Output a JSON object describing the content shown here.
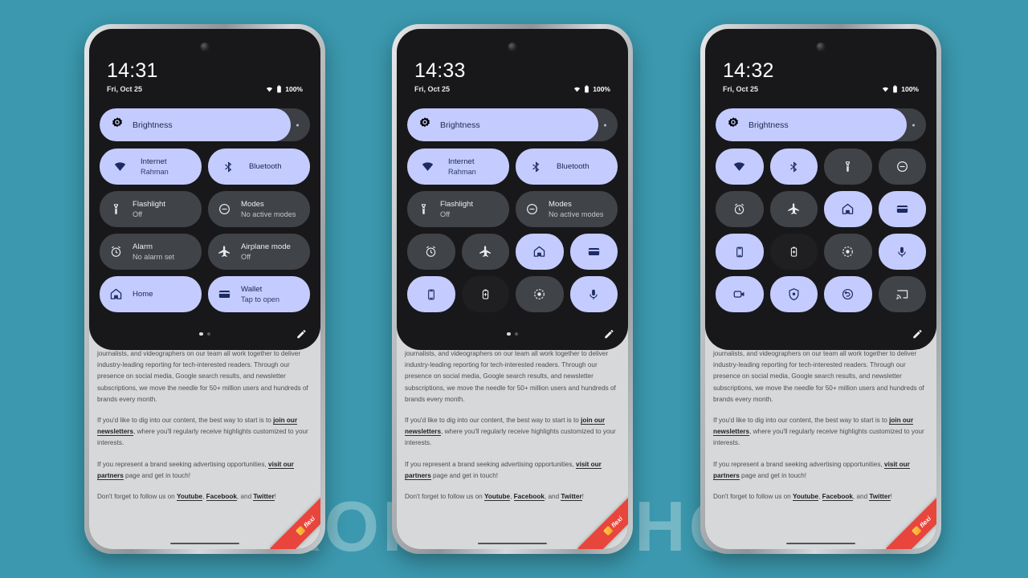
{
  "background": {
    "color": "#3b98ae",
    "watermark": "ANDROID AUTHORITY"
  },
  "ribbon": {
    "text": "flexi"
  },
  "article": {
    "p1": "journalists, and videographers on our team all work together to deliver industry-leading reporting for tech-interested readers. Through our presence on social media, Google search results, and newsletter subscriptions, we move the needle for 50+ million users and hundreds of brands every month.",
    "p2_a": "If you'd like to dig into our content, the best way to start is to ",
    "p2_link1": "join our newsletters",
    "p2_b": ", where you'll regularly receive highlights customized to your interests.",
    "p3_a": "If you represent a brand seeking advertising opportunities, ",
    "p3_link1": "visit our partners",
    "p3_b": " page and get in touch!",
    "p4_a": "Don't forget to follow us on ",
    "p4_link1": "Youtube",
    "p4_sep1": ", ",
    "p4_link2": "Facebook",
    "p4_sep2": ", and ",
    "p4_link3": "Twitter",
    "p4_end": "!"
  },
  "colors": {
    "tile_active_bg": "#c4ccff",
    "tile_active_fg": "#1d2a63",
    "tile_inactive_bg": "#404348",
    "tile_off_dark_bg": "#1f1f21",
    "panel_bg": "#18181a",
    "brightness_fill": "#c4ccff",
    "brightness_track": "#3c3f44"
  },
  "phones": [
    {
      "id": "phone-1",
      "layout": "wide-only",
      "status": {
        "time": "14:31",
        "date": "Fri, Oct 25",
        "battery": "100%",
        "wifi_icon": "wifi-icon",
        "battery_icon": "battery-icon"
      },
      "brightness": {
        "label": "Brightness",
        "icon": "brightness-icon",
        "percent": 91
      },
      "rows": [
        [
          {
            "name": "internet",
            "icon": "wifi-icon",
            "title": "Internet",
            "subtitle": "Rahman",
            "state": "on",
            "style": "bubble"
          },
          {
            "name": "bluetooth",
            "icon": "bluetooth-icon",
            "title": "Bluetooth",
            "subtitle": "",
            "state": "on",
            "style": "bubble"
          }
        ],
        [
          {
            "name": "flashlight",
            "icon": "flashlight-icon",
            "title": "Flashlight",
            "subtitle": "Off",
            "state": "off",
            "style": "plain"
          },
          {
            "name": "modes",
            "icon": "modes-icon",
            "title": "Modes",
            "subtitle": "No active modes",
            "state": "off",
            "style": "plain"
          }
        ],
        [
          {
            "name": "alarm",
            "icon": "alarm-icon",
            "title": "Alarm",
            "subtitle": "No alarm set",
            "state": "off",
            "style": "plain"
          },
          {
            "name": "airplane-mode",
            "icon": "airplane-icon",
            "title": "Airplane mode",
            "subtitle": "Off",
            "state": "off",
            "style": "plain"
          }
        ],
        [
          {
            "name": "home",
            "icon": "home-icon",
            "title": "Home",
            "subtitle": "",
            "state": "on",
            "style": "plain"
          },
          {
            "name": "wallet",
            "icon": "wallet-icon",
            "title": "Wallet",
            "subtitle": "Tap to open",
            "state": "on",
            "style": "plain"
          }
        ]
      ],
      "footer": {
        "dots": 2,
        "active_dot": 0,
        "edit_icon": "pencil-icon"
      }
    },
    {
      "id": "phone-2",
      "layout": "mixed",
      "status": {
        "time": "14:33",
        "date": "Fri, Oct 25",
        "battery": "100%",
        "wifi_icon": "wifi-icon",
        "battery_icon": "battery-icon"
      },
      "brightness": {
        "label": "Brightness",
        "icon": "brightness-icon",
        "percent": 91
      },
      "rows": [
        [
          {
            "name": "internet",
            "icon": "wifi-icon",
            "title": "Internet",
            "subtitle": "Rahman",
            "state": "on",
            "style": "bubble"
          },
          {
            "name": "bluetooth",
            "icon": "bluetooth-icon",
            "title": "Bluetooth",
            "subtitle": "",
            "state": "on",
            "style": "bubble"
          }
        ],
        [
          {
            "name": "flashlight",
            "icon": "flashlight-icon",
            "title": "Flashlight",
            "subtitle": "Off",
            "state": "off",
            "style": "plain"
          },
          {
            "name": "modes",
            "icon": "modes-icon",
            "title": "Modes",
            "subtitle": "No active modes",
            "state": "off",
            "style": "plain"
          }
        ],
        [
          {
            "name": "alarm",
            "icon": "alarm-icon",
            "title": "",
            "subtitle": "",
            "state": "off",
            "style": "icononly"
          },
          {
            "name": "airplane-mode",
            "icon": "airplane-icon",
            "title": "",
            "subtitle": "",
            "state": "off",
            "style": "icononly"
          },
          {
            "name": "home",
            "icon": "home-icon",
            "title": "",
            "subtitle": "",
            "state": "on",
            "style": "icononly"
          },
          {
            "name": "wallet",
            "icon": "wallet-icon",
            "title": "",
            "subtitle": "",
            "state": "on",
            "style": "icononly"
          }
        ],
        [
          {
            "name": "auto-rotate",
            "icon": "rotate-icon",
            "title": "",
            "subtitle": "",
            "state": "on",
            "style": "icononly"
          },
          {
            "name": "battery-saver",
            "icon": "battery-saver-icon",
            "title": "",
            "subtitle": "",
            "state": "off-dark",
            "style": "icononly"
          },
          {
            "name": "screen-record",
            "icon": "record-icon",
            "title": "",
            "subtitle": "",
            "state": "off",
            "style": "icononly"
          },
          {
            "name": "microphone",
            "icon": "mic-icon",
            "title": "",
            "subtitle": "",
            "state": "on",
            "style": "icononly"
          }
        ]
      ],
      "footer": {
        "dots": 2,
        "active_dot": 0,
        "edit_icon": "pencil-icon"
      }
    },
    {
      "id": "phone-3",
      "layout": "icon-grid",
      "status": {
        "time": "14:32",
        "date": "Fri, Oct 25",
        "battery": "100%",
        "wifi_icon": "wifi-icon",
        "battery_icon": "battery-icon"
      },
      "brightness": {
        "label": "Brightness",
        "icon": "brightness-icon",
        "percent": 91
      },
      "rows": [
        [
          {
            "name": "internet",
            "icon": "wifi-icon",
            "title": "",
            "subtitle": "",
            "state": "on",
            "style": "icononly"
          },
          {
            "name": "bluetooth",
            "icon": "bluetooth-icon",
            "title": "",
            "subtitle": "",
            "state": "on",
            "style": "icononly"
          },
          {
            "name": "flashlight",
            "icon": "flashlight-icon",
            "title": "",
            "subtitle": "",
            "state": "off",
            "style": "icononly"
          },
          {
            "name": "modes",
            "icon": "modes-icon",
            "title": "",
            "subtitle": "",
            "state": "off",
            "style": "icononly"
          }
        ],
        [
          {
            "name": "alarm",
            "icon": "alarm-icon",
            "title": "",
            "subtitle": "",
            "state": "off",
            "style": "icononly"
          },
          {
            "name": "airplane-mode",
            "icon": "airplane-icon",
            "title": "",
            "subtitle": "",
            "state": "off",
            "style": "icononly"
          },
          {
            "name": "home",
            "icon": "home-icon",
            "title": "",
            "subtitle": "",
            "state": "on",
            "style": "icononly"
          },
          {
            "name": "wallet",
            "icon": "wallet-icon",
            "title": "",
            "subtitle": "",
            "state": "on",
            "style": "icononly"
          }
        ],
        [
          {
            "name": "auto-rotate",
            "icon": "rotate-icon",
            "title": "",
            "subtitle": "",
            "state": "on",
            "style": "icononly"
          },
          {
            "name": "battery-saver",
            "icon": "battery-saver-icon",
            "title": "",
            "subtitle": "",
            "state": "off-dark",
            "style": "icononly"
          },
          {
            "name": "screen-record",
            "icon": "record-icon",
            "title": "",
            "subtitle": "",
            "state": "off",
            "style": "icononly"
          },
          {
            "name": "microphone",
            "icon": "mic-icon",
            "title": "",
            "subtitle": "",
            "state": "on",
            "style": "icononly"
          }
        ],
        [
          {
            "name": "screen-capture",
            "icon": "videocam-icon",
            "title": "",
            "subtitle": "",
            "state": "on",
            "style": "icononly"
          },
          {
            "name": "privacy-shield",
            "icon": "shield-icon",
            "title": "",
            "subtitle": "",
            "state": "on",
            "style": "icononly"
          },
          {
            "name": "sync",
            "icon": "sync-icon",
            "title": "",
            "subtitle": "",
            "state": "on",
            "style": "icononly"
          },
          {
            "name": "cast",
            "icon": "cast-icon",
            "title": "",
            "subtitle": "",
            "state": "off",
            "style": "icononly"
          }
        ]
      ],
      "footer": {
        "dots": 0,
        "active_dot": -1,
        "edit_icon": "pencil-icon"
      }
    }
  ]
}
